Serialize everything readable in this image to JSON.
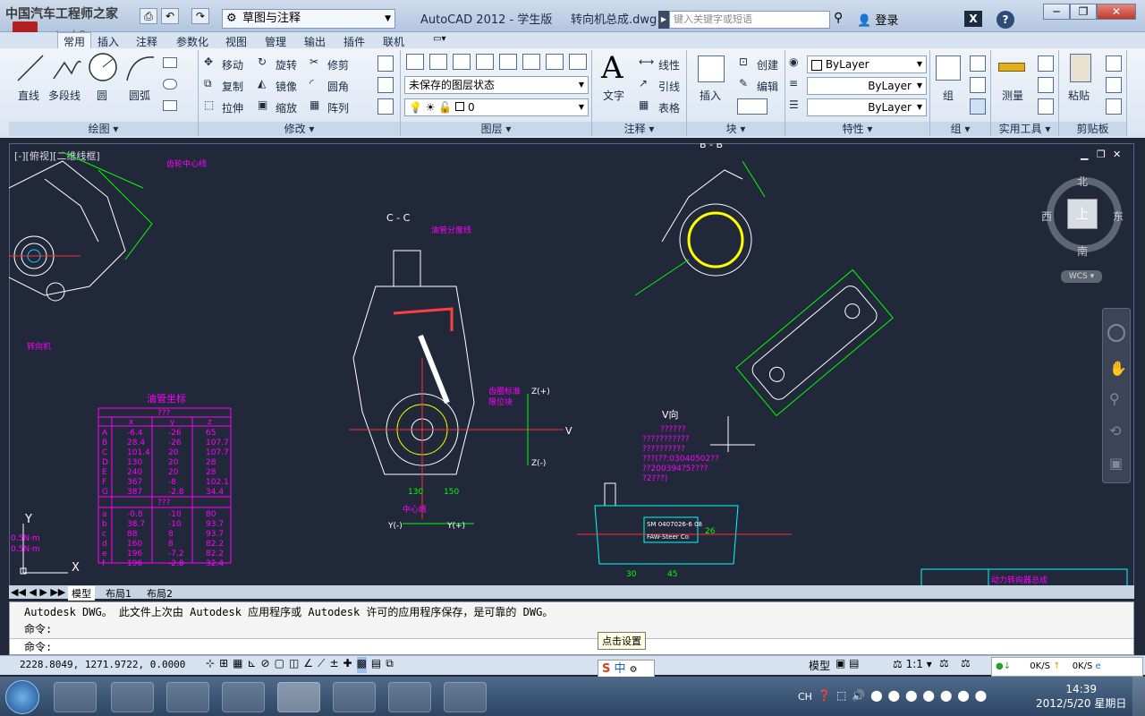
{
  "window": {
    "app_title": "AutoCAD 2012 - 学生版",
    "file_name": "转向机总成.dwg",
    "workspace": "草图与注释",
    "search_placeholder": "键入关键字或短语",
    "login": "登录",
    "watermark": "中国汽车工程师之家",
    "watermark_url": "www.cartech8.com"
  },
  "ribbon_tabs": [
    "常用",
    "插入",
    "注释",
    "参数化",
    "视图",
    "管理",
    "输出",
    "插件",
    "联机"
  ],
  "panels": {
    "draw": {
      "title": "绘图",
      "line": "直线",
      "polyline": "多段线",
      "circle": "圆",
      "arc": "圆弧"
    },
    "modify": {
      "title": "修改",
      "move": "移动",
      "rotate": "旋转",
      "trim": "修剪",
      "copy": "复制",
      "mirror": "镜像",
      "fillet": "圆角",
      "stretch": "拉伸",
      "scale": "缩放",
      "array": "阵列"
    },
    "layers": {
      "title": "图层",
      "state": "未保存的图层状态",
      "current": "0"
    },
    "annotation": {
      "title": "注释",
      "text": "文字",
      "linear": "线性",
      "leader": "引线",
      "table": "表格"
    },
    "block": {
      "title": "块",
      "insert": "插入",
      "create": "创建",
      "edit": "编辑"
    },
    "properties": {
      "title": "特性",
      "color": "ByLayer",
      "linetype": "ByLayer",
      "lineweight": "ByLayer"
    },
    "groups": {
      "title": "组",
      "group": "组"
    },
    "utilities": {
      "title": "实用工具",
      "measure": "测量"
    },
    "clipboard": {
      "title": "剪贴板",
      "paste": "粘贴"
    }
  },
  "viewport": {
    "label": "[-][俯视][二维线框]",
    "viewcube": {
      "north": "北",
      "south": "南",
      "east": "东",
      "west": "西",
      "top": "上",
      "wcs": "WCS"
    }
  },
  "drawing_text": {
    "section_cc": "C - C",
    "section_bb": "B - B",
    "view_v": "V向",
    "v_label": "V",
    "table_title": "油管坐标",
    "table_sub": "???",
    "table_headers": [
      "x",
      "y",
      "z"
    ],
    "table_rows_1": [
      [
        "A",
        "-6.4",
        "-26",
        "65"
      ],
      [
        "B",
        "28.4",
        "-26",
        "107.7"
      ],
      [
        "C",
        "101.4",
        "20",
        "107.7"
      ],
      [
        "D",
        "130",
        "20",
        "28"
      ],
      [
        "E",
        "240",
        "20",
        "28"
      ],
      [
        "F",
        "367",
        "-8",
        "102.1"
      ],
      [
        "G",
        "387",
        "-2.8",
        "34.4"
      ]
    ],
    "table_rows_2": [
      [
        "a",
        "-0.8",
        "-10",
        "80"
      ],
      [
        "b",
        "38.7",
        "-10",
        "93.7"
      ],
      [
        "c",
        "88",
        "8",
        "93.7"
      ],
      [
        "d",
        "160",
        "8",
        "82.2"
      ],
      [
        "e",
        "196",
        "-7.2",
        "82.2"
      ],
      [
        "f",
        "196",
        "-2.8",
        "32.4"
      ]
    ],
    "note_lines": [
      "??????",
      "???????????",
      "??????????",
      "???(??:03040502??",
      "??200394?5????",
      "?2???)"
    ],
    "dim_y_minus": "Y(-)",
    "dim_y_plus": "Y(+)",
    "dim_z_plus": "Z(+)",
    "dim_z_minus": "Z(-)",
    "label_1": "齿轮中心线",
    "label_2": "转向机",
    "label_3": "油管分度线",
    "label_4": "齿圈标准",
    "label_5": "限位块",
    "label_6": "中心线",
    "dim_130": "130",
    "dim_150": "150",
    "dim_45": "45",
    "dim_30": "30",
    "dim_26": "26",
    "nameplate_1": "SM 0407026-6 08",
    "nameplate_2": "FAW-Steer Co",
    "title_block_label": "动力转向器总成",
    "torque_1": "0.5N·m",
    "torque_2": "0.5N·m"
  },
  "layout_tabs": [
    "模型",
    "布局1",
    "布局2"
  ],
  "command": {
    "line1": "Autodesk DWG。  此文件上次由 Autodesk 应用程序或 Autodesk 许可的应用程序保存，是可靠的 DWG。",
    "line2": "命令:",
    "line3": "命令:"
  },
  "status": {
    "coords": "2228.8049, 1271.9722, 0.0000",
    "model": "模型",
    "scale": "1:1",
    "net_down": "0K/S",
    "net_up": "0K/S"
  },
  "tooltip": "点击设置",
  "ime": "中",
  "taskbar": {
    "lang": "CH",
    "time": "14:39",
    "date": "2012/5/20 星期日"
  }
}
